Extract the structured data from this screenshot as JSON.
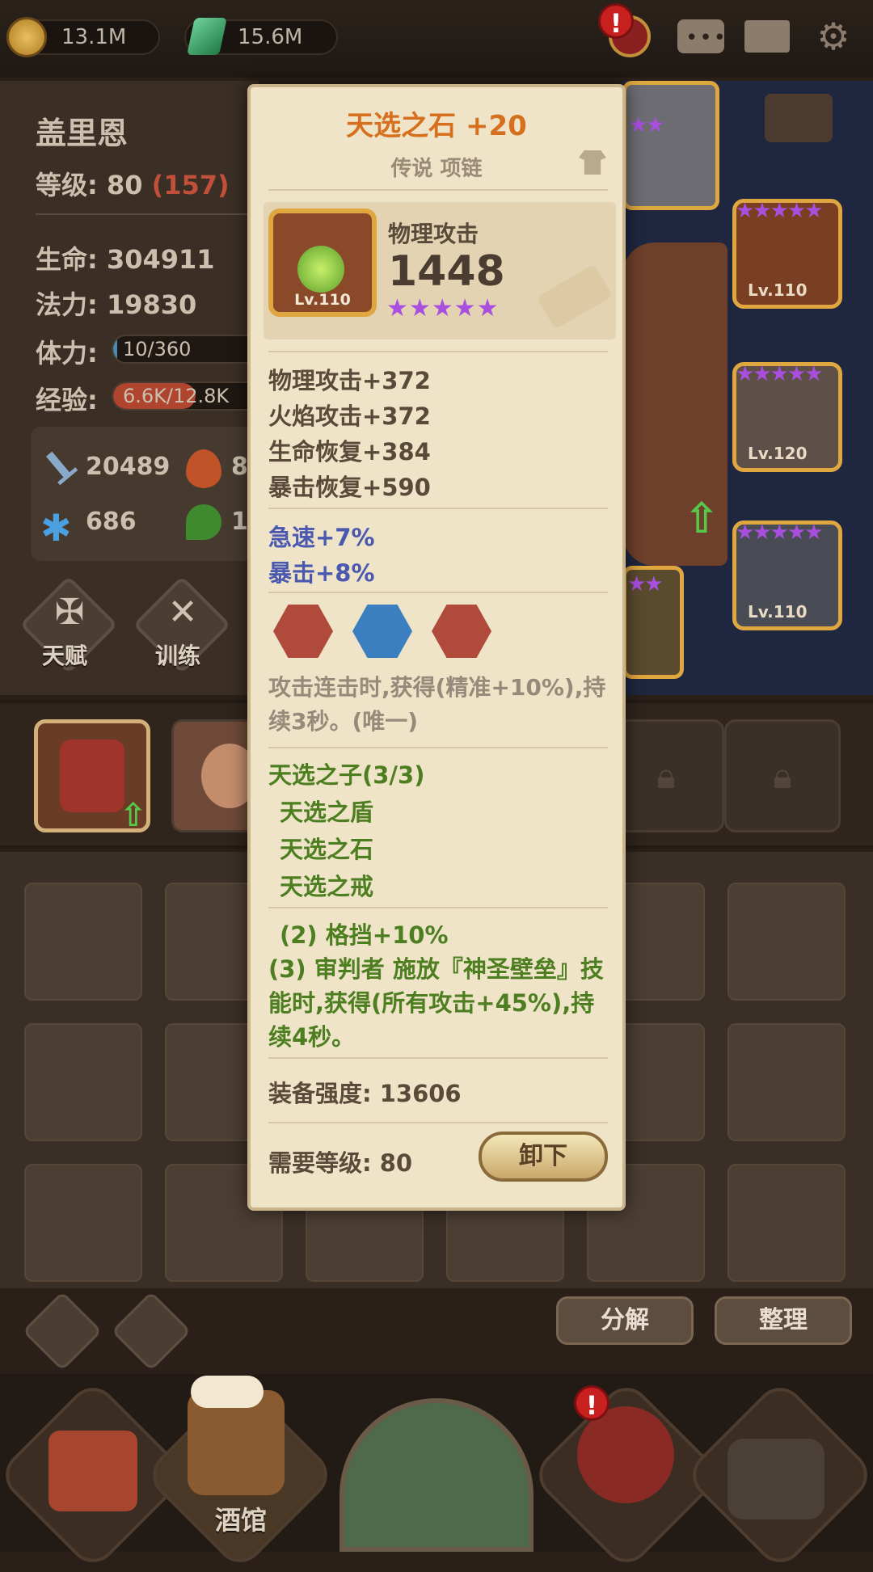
{
  "currency": {
    "gold": "13.1M",
    "gems": "15.6M"
  },
  "top_icons": [
    "alert-icon",
    "hero-pot-icon",
    "chat-icon",
    "mail-icon",
    "gear-icon"
  ],
  "alert_mark": "!",
  "hero": {
    "name": "盖里恩",
    "level_label": "等级:",
    "level": "80",
    "level_extra": "(157)",
    "hp_label": "生命:",
    "hp": "304911",
    "mp_label": "法力:",
    "mp": "19830",
    "stamina_label": "体力:",
    "stamina": "10/360",
    "stamina_fill": 0.028,
    "exp_label": "经验:",
    "exp": "6.6K/12.8K",
    "exp_fill": 0.52,
    "stats": {
      "attack": "20489",
      "fire": "8",
      "frost": "686",
      "nature": "1"
    }
  },
  "actions": {
    "talent": "天赋",
    "train": "训练"
  },
  "inventory_buttons": {
    "decompose": "分解",
    "sort": "整理"
  },
  "nav": {
    "tavern": "酒馆"
  },
  "gear_levels": [
    "Lv.110",
    "Lv.120",
    "Lv.110"
  ],
  "item": {
    "name": "天选之石 +20",
    "type": "传说 项链",
    "main_stat_label": "物理攻击",
    "main_stat_value": "1448",
    "level": "Lv.110",
    "stars": "★★★★★",
    "bonuses": [
      "物理攻击+372",
      "火焰攻击+372",
      "生命恢复+384",
      "暴击恢复+590"
    ],
    "specials": [
      "急速+7%",
      "暴击+8%"
    ],
    "gem_colors": [
      "#b04a3a",
      "#3c7fc0",
      "#b04a3a"
    ],
    "passive": "攻击连击时,获得(精准+10%),持续3秒。(唯一)",
    "set_title": "天选之子(3/3)",
    "set_items": [
      "天选之盾",
      "天选之石",
      "天选之戒"
    ],
    "set_bonus_2": "(2) 格挡+10%",
    "set_bonus_3": "(3) 审判者 施放『神圣壁垒』技能时,获得(所有攻击+45%),持续4秒。",
    "power_label": "装备强度:",
    "power": "13606",
    "req_label": "需要等级:",
    "req_level": "80",
    "unequip": "卸下"
  },
  "colors": {
    "title": "#d6701e",
    "green": "#4d7f21",
    "blue": "#4b58b0",
    "parchment": "#efe3c8"
  }
}
